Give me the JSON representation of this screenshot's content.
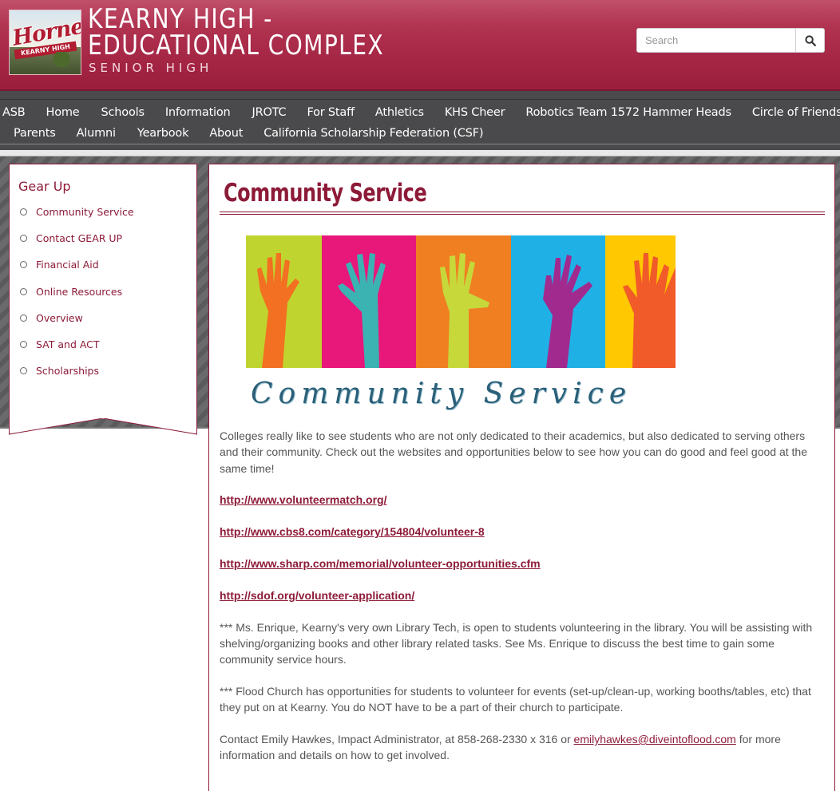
{
  "header": {
    "title_line1": "KEARNY HIGH -",
    "title_line2": "EDUCATIONAL COMPLEX",
    "subtitle": "SENIOR HIGH",
    "logo": {
      "script": "Hornets",
      "band": "KEARNY HIGH"
    },
    "search": {
      "placeholder": "Search",
      "icon": "search-icon"
    }
  },
  "nav": {
    "row1": [
      "ASB",
      "Home",
      "Schools",
      "Information",
      "JROTC",
      "For Staff",
      "Athletics",
      "KHS Cheer",
      "Robotics Team 1572 Hammer Heads",
      "Circle of Friends"
    ],
    "row2": [
      "Parents",
      "Alumni",
      "Yearbook",
      "About",
      "California Scholarship Federation (CSF)"
    ]
  },
  "sidebar": {
    "title": "Gear Up",
    "items": [
      "Community Service",
      "Contact GEAR UP",
      "Financial Aid",
      "Online Resources",
      "Overview",
      "SAT and ACT",
      "Scholarships"
    ]
  },
  "main": {
    "title": "Community Service",
    "banner_text": "Community Service",
    "banner_colors": [
      "#c0d42f",
      "#e8177a",
      "#f07f22",
      "#1fb1e6",
      "#ffc800"
    ],
    "intro": "Colleges really like to see students who are not only dedicated to their academics, but also dedicated to serving others and their community.  Check out the websites and opportunities below to see how you can do good and feel good at the same time!",
    "links": [
      "http://www.volunteermatch.org/",
      "http://www.cbs8.com/category/154804/volunteer-8",
      "http://www.sharp.com/memorial/volunteer-opportunities.cfm",
      "http://sdof.org/volunteer-application/ "
    ],
    "library_note": "*** Ms. Enrique, Kearny's very own Library Tech, is open to students volunteering in the library.  You will be assisting with shelving/organizing books and other library related tasks.  See Ms. Enrique to discuss the best time to gain some community service hours.",
    "church_note": "*** Flood Church has opportunities for students to volunteer for events (set-up/clean-up, working booths/tables, etc) that they put on at Kearny.  You do NOT have to be a part of their church to participate.",
    "contact_before": "Contact Emily Hawkes, Impact Administrator, at 858-268-2330 x 316 or ",
    "contact_email": "emilyhawkes@diveintoflood.com",
    "contact_after": " for more information and details on how to get involved."
  }
}
